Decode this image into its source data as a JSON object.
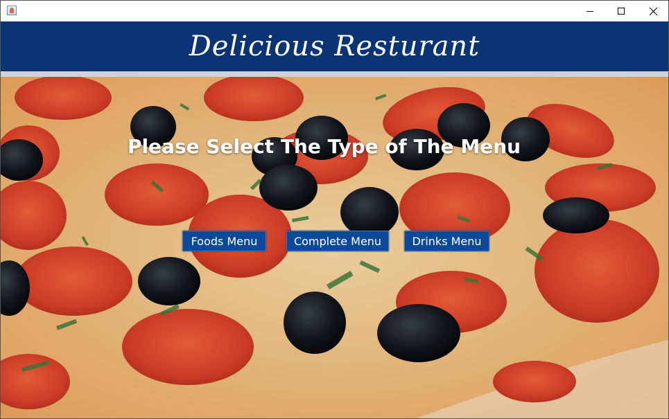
{
  "window": {
    "icon": "java-cup-icon",
    "controls": [
      "minimize-icon",
      "maximize-icon",
      "close-icon"
    ]
  },
  "header": {
    "title": "Delicious Resturant",
    "background_color": "#0b3475"
  },
  "main": {
    "prompt": "Please Select The Type of The Menu",
    "background_image": "pepperoni-olive-pizza",
    "buttons": {
      "foods": "Foods Menu",
      "complete": "Complete Menu",
      "drinks": "Drinks Menu"
    },
    "button_color": "#0b4a9a"
  }
}
